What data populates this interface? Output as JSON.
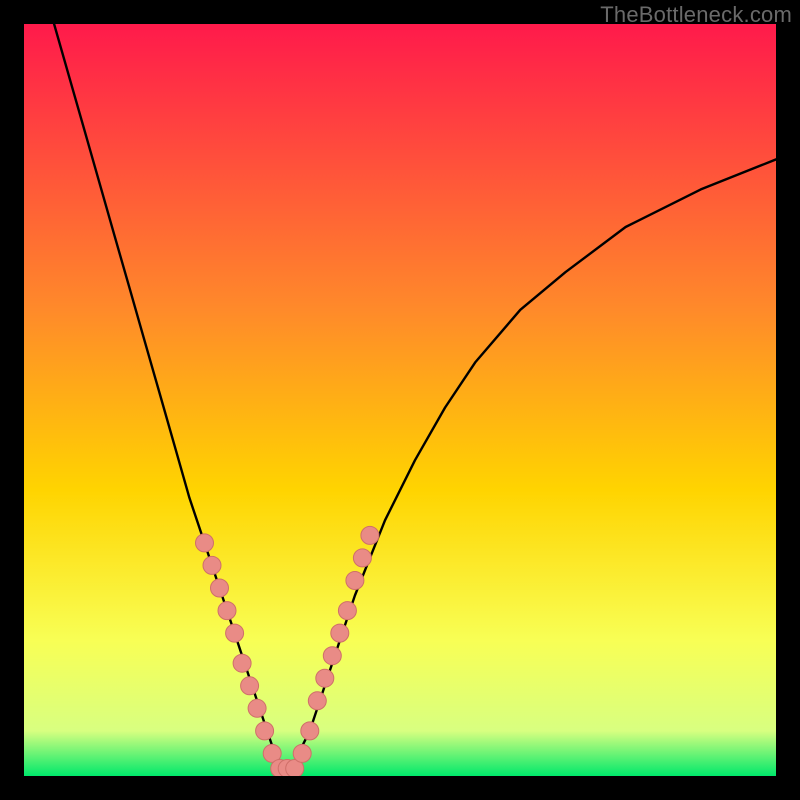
{
  "watermark": "TheBottleneck.com",
  "colors": {
    "bg_black": "#000000",
    "gradient_top": "#ff1a4b",
    "gradient_mid1": "#ff6a2a",
    "gradient_mid2": "#ffd400",
    "gradient_mid3": "#f8ff55",
    "gradient_bottom": "#00e86b",
    "curve": "#000000",
    "marker_fill": "#e98b86",
    "marker_stroke": "#cf6f69"
  },
  "chart_data": {
    "type": "line",
    "title": "",
    "xlabel": "",
    "ylabel": "",
    "xlim": [
      0,
      100
    ],
    "ylim": [
      0,
      100
    ],
    "series": [
      {
        "name": "bottleneck-curve",
        "x": [
          4,
          6,
          8,
          10,
          12,
          14,
          16,
          18,
          20,
          22,
          24,
          26,
          28,
          30,
          32,
          33,
          34,
          35,
          36,
          38,
          40,
          42,
          44,
          48,
          52,
          56,
          60,
          66,
          72,
          80,
          90,
          100
        ],
        "y": [
          100,
          93,
          86,
          79,
          72,
          65,
          58,
          51,
          44,
          37,
          31,
          25,
          19,
          13,
          7,
          4,
          2,
          1,
          2,
          6,
          12,
          18,
          24,
          34,
          42,
          49,
          55,
          62,
          67,
          73,
          78,
          82
        ],
        "values": []
      }
    ],
    "markers": {
      "name": "highlighted-points",
      "points": [
        {
          "x": 24,
          "y": 31
        },
        {
          "x": 25,
          "y": 28
        },
        {
          "x": 26,
          "y": 25
        },
        {
          "x": 27,
          "y": 22
        },
        {
          "x": 28,
          "y": 19
        },
        {
          "x": 29,
          "y": 15
        },
        {
          "x": 30,
          "y": 12
        },
        {
          "x": 31,
          "y": 9
        },
        {
          "x": 32,
          "y": 6
        },
        {
          "x": 33,
          "y": 3
        },
        {
          "x": 34,
          "y": 1
        },
        {
          "x": 35,
          "y": 1
        },
        {
          "x": 36,
          "y": 1
        },
        {
          "x": 37,
          "y": 3
        },
        {
          "x": 38,
          "y": 6
        },
        {
          "x": 39,
          "y": 10
        },
        {
          "x": 40,
          "y": 13
        },
        {
          "x": 41,
          "y": 16
        },
        {
          "x": 42,
          "y": 19
        },
        {
          "x": 43,
          "y": 22
        },
        {
          "x": 44,
          "y": 26
        },
        {
          "x": 45,
          "y": 29
        },
        {
          "x": 46,
          "y": 32
        }
      ]
    }
  }
}
